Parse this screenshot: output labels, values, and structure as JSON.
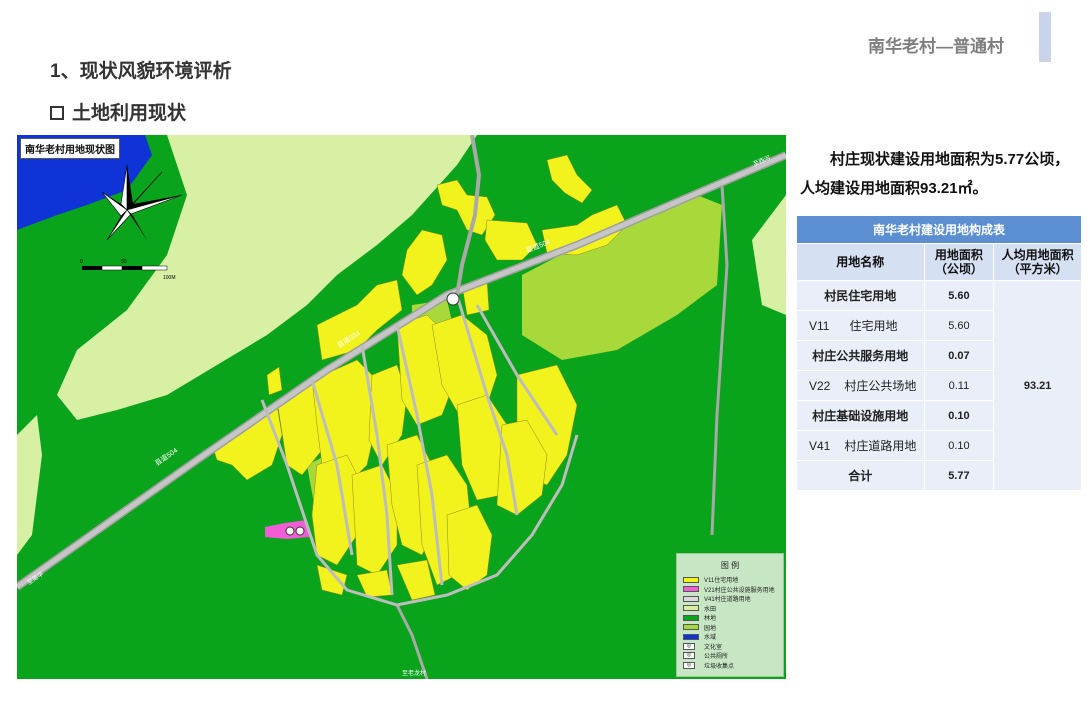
{
  "header": {
    "title": "南华老村—普通村"
  },
  "section_title": "1、现状风貌环境评析",
  "sub_title": "土地利用现状",
  "map": {
    "title": "南华老村用地现状图",
    "road_label_1": "县道504",
    "road_label_2": "县道504",
    "road_label_3": "县道504",
    "compass_label": "N",
    "scale_labels": [
      "0",
      "50",
      "100M"
    ],
    "edge_label_top": "至西河",
    "edge_label_left": "至南华",
    "edge_label_bottom": "至老龙村",
    "legend": {
      "title": "图 例",
      "items": [
        {
          "label": "V11住宅用地",
          "color": "#f2f21c"
        },
        {
          "label": "V21村庄公共设施服务用地",
          "color": "#f25cd6"
        },
        {
          "label": "V41村庄道路用地",
          "color": "#d9d9d9"
        },
        {
          "label": "水田",
          "color": "#d7f0a4"
        },
        {
          "label": "林地",
          "color": "#0aa31c"
        },
        {
          "label": "园地",
          "color": "#a8d83a"
        },
        {
          "label": "水域",
          "color": "#1033d8"
        }
      ],
      "symbols": [
        {
          "label": "文化室",
          "icon": "culture-icon"
        },
        {
          "label": "公共厕所",
          "icon": "toilet-icon"
        },
        {
          "label": "垃圾收集点",
          "icon": "garbage-icon"
        }
      ]
    }
  },
  "summary": "村庄现状建设用地面积为5.77公顷，人均建设用地面积93.21㎡。",
  "table": {
    "caption": "南华老村建设用地构成表",
    "headers": {
      "name": "用地名称",
      "area": "用地面积（公顷）",
      "per_capita": "人均用地面积（平方米）"
    },
    "rows": [
      {
        "code": "",
        "name": "村民住宅用地",
        "area": "5.60",
        "bold": true
      },
      {
        "code": "V11",
        "name": "住宅用地",
        "area": "5.60",
        "bold": false
      },
      {
        "code": "",
        "name": "村庄公共服务用地",
        "area": "0.07",
        "bold": true
      },
      {
        "code": "V22",
        "name": "村庄公共场地",
        "area": "0.11",
        "bold": false
      },
      {
        "code": "",
        "name": "村庄基础设施用地",
        "area": "0.10",
        "bold": true
      },
      {
        "code": "V41",
        "name": "村庄道路用地",
        "area": "0.10",
        "bold": false
      }
    ],
    "per_capita_value": "93.21",
    "total_label": "合计",
    "total_area": "5.77"
  }
}
